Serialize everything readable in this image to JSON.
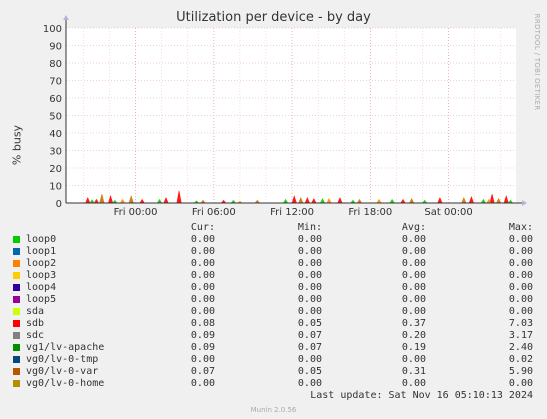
{
  "window": {
    "background_color": "#f0f0f0"
  },
  "chart_data": {
    "type": "area",
    "title": "Utilization per device - by day",
    "ylabel": "% busy",
    "xlabel": "",
    "ylim": [
      0,
      100
    ],
    "yticks": [
      0,
      10,
      20,
      30,
      40,
      50,
      60,
      70,
      80,
      90,
      100
    ],
    "xticks": [
      "Fri 00:00",
      "Fri 06:00",
      "Fri 12:00",
      "Fri 18:00",
      "Sat 00:00"
    ],
    "grid": true,
    "series": [
      {
        "name": "sdb",
        "color": "#ff0000",
        "values": [
          {
            "x": "Thu 20:20",
            "y": 3
          },
          {
            "x": "Thu 21:00",
            "y": 2
          },
          {
            "x": "Thu 22:05",
            "y": 4
          },
          {
            "x": "Fri 00:30",
            "y": 2
          },
          {
            "x": "Fri 02:20",
            "y": 3
          },
          {
            "x": "Fri 03:20",
            "y": 7
          },
          {
            "x": "Fri 06:45",
            "y": 1.5
          },
          {
            "x": "Fri 12:10",
            "y": 4
          },
          {
            "x": "Fri 13:10",
            "y": 3
          },
          {
            "x": "Fri 13:40",
            "y": 2.5
          },
          {
            "x": "Fri 15:40",
            "y": 3
          },
          {
            "x": "Fri 20:30",
            "y": 2
          },
          {
            "x": "Fri 23:20",
            "y": 3
          },
          {
            "x": "Sat 01:45",
            "y": 3.5
          },
          {
            "x": "Sat 03:20",
            "y": 5
          },
          {
            "x": "Sat 04:25",
            "y": 4
          }
        ]
      },
      {
        "name": "vg1/lv-apache",
        "color": "#00cc00",
        "values": [
          {
            "x": "Thu 20:40",
            "y": 1.8
          },
          {
            "x": "Thu 22:25",
            "y": 1.5
          },
          {
            "x": "Fri 01:50",
            "y": 2
          },
          {
            "x": "Fri 04:40",
            "y": 1.2
          },
          {
            "x": "Fri 07:30",
            "y": 1.5
          },
          {
            "x": "Fri 11:30",
            "y": 2
          },
          {
            "x": "Fri 14:20",
            "y": 2.4
          },
          {
            "x": "Fri 16:40",
            "y": 1.6
          },
          {
            "x": "Fri 19:40",
            "y": 2
          },
          {
            "x": "Fri 22:10",
            "y": 1.5
          },
          {
            "x": "Sat 02:40",
            "y": 2
          },
          {
            "x": "Sat 04:45",
            "y": 1.6
          }
        ]
      },
      {
        "name": "vg0/lv-0-var",
        "color": "#cc7000",
        "values": [
          {
            "x": "Thu 21:25",
            "y": 5
          },
          {
            "x": "Thu 23:40",
            "y": 4
          },
          {
            "x": "Fri 05:10",
            "y": 1.5
          },
          {
            "x": "Fri 09:20",
            "y": 1.5
          },
          {
            "x": "Fri 12:40",
            "y": 3
          },
          {
            "x": "Fri 17:10",
            "y": 2
          },
          {
            "x": "Fri 21:10",
            "y": 2.5
          },
          {
            "x": "Sat 01:10",
            "y": 3
          },
          {
            "x": "Sat 03:50",
            "y": 2.5
          }
        ]
      },
      {
        "name": "sdc",
        "color": "#ff8800",
        "values": [
          {
            "x": "Thu 23:00",
            "y": 2
          },
          {
            "x": "Fri 08:00",
            "y": 1
          },
          {
            "x": "Fri 14:50",
            "y": 2.5
          },
          {
            "x": "Fri 18:40",
            "y": 2
          },
          {
            "x": "Sat 03:05",
            "y": 2
          }
        ]
      }
    ]
  },
  "legend": {
    "headers": {
      "cur": "Cur:",
      "min": "Min:",
      "avg": "Avg:",
      "max": "Max:"
    },
    "rows": [
      {
        "name": "loop0",
        "color": "#00cc00",
        "cur": "0.00",
        "min": "0.00",
        "avg": "0.00",
        "max": "0.00"
      },
      {
        "name": "loop1",
        "color": "#0066b3",
        "cur": "0.00",
        "min": "0.00",
        "avg": "0.00",
        "max": "0.00"
      },
      {
        "name": "loop2",
        "color": "#ff8000",
        "cur": "0.00",
        "min": "0.00",
        "avg": "0.00",
        "max": "0.00"
      },
      {
        "name": "loop3",
        "color": "#ffcc00",
        "cur": "0.00",
        "min": "0.00",
        "avg": "0.00",
        "max": "0.00"
      },
      {
        "name": "loop4",
        "color": "#330099",
        "cur": "0.00",
        "min": "0.00",
        "avg": "0.00",
        "max": "0.00"
      },
      {
        "name": "loop5",
        "color": "#990099",
        "cur": "0.00",
        "min": "0.00",
        "avg": "0.00",
        "max": "0.00"
      },
      {
        "name": "sda",
        "color": "#ccff00",
        "cur": "0.00",
        "min": "0.00",
        "avg": "0.00",
        "max": "0.00"
      },
      {
        "name": "sdb",
        "color": "#ff0000",
        "cur": "0.08",
        "min": "0.05",
        "avg": "0.37",
        "max": "7.03"
      },
      {
        "name": "sdc",
        "color": "#808080",
        "cur": "0.09",
        "min": "0.07",
        "avg": "0.20",
        "max": "3.17"
      },
      {
        "name": "vg1/lv-apache",
        "color": "#008f00",
        "cur": "0.09",
        "min": "0.07",
        "avg": "0.19",
        "max": "2.40"
      },
      {
        "name": "vg0/lv-0-tmp",
        "color": "#00487d",
        "cur": "0.00",
        "min": "0.00",
        "avg": "0.00",
        "max": "0.02"
      },
      {
        "name": "vg0/lv-0-var",
        "color": "#b35a00",
        "cur": "0.07",
        "min": "0.05",
        "avg": "0.31",
        "max": "5.90"
      },
      {
        "name": "vg0/lv-0-home",
        "color": "#b38f00",
        "cur": "0.00",
        "min": "0.00",
        "avg": "0.00",
        "max": "0.00"
      }
    ]
  },
  "footer": {
    "last_update": "Last update: Sat Nov 16 05:10:13 2024",
    "version": "Munin 2.0.56"
  },
  "watermark": "RRDTOOL / TOBI OETIKER"
}
